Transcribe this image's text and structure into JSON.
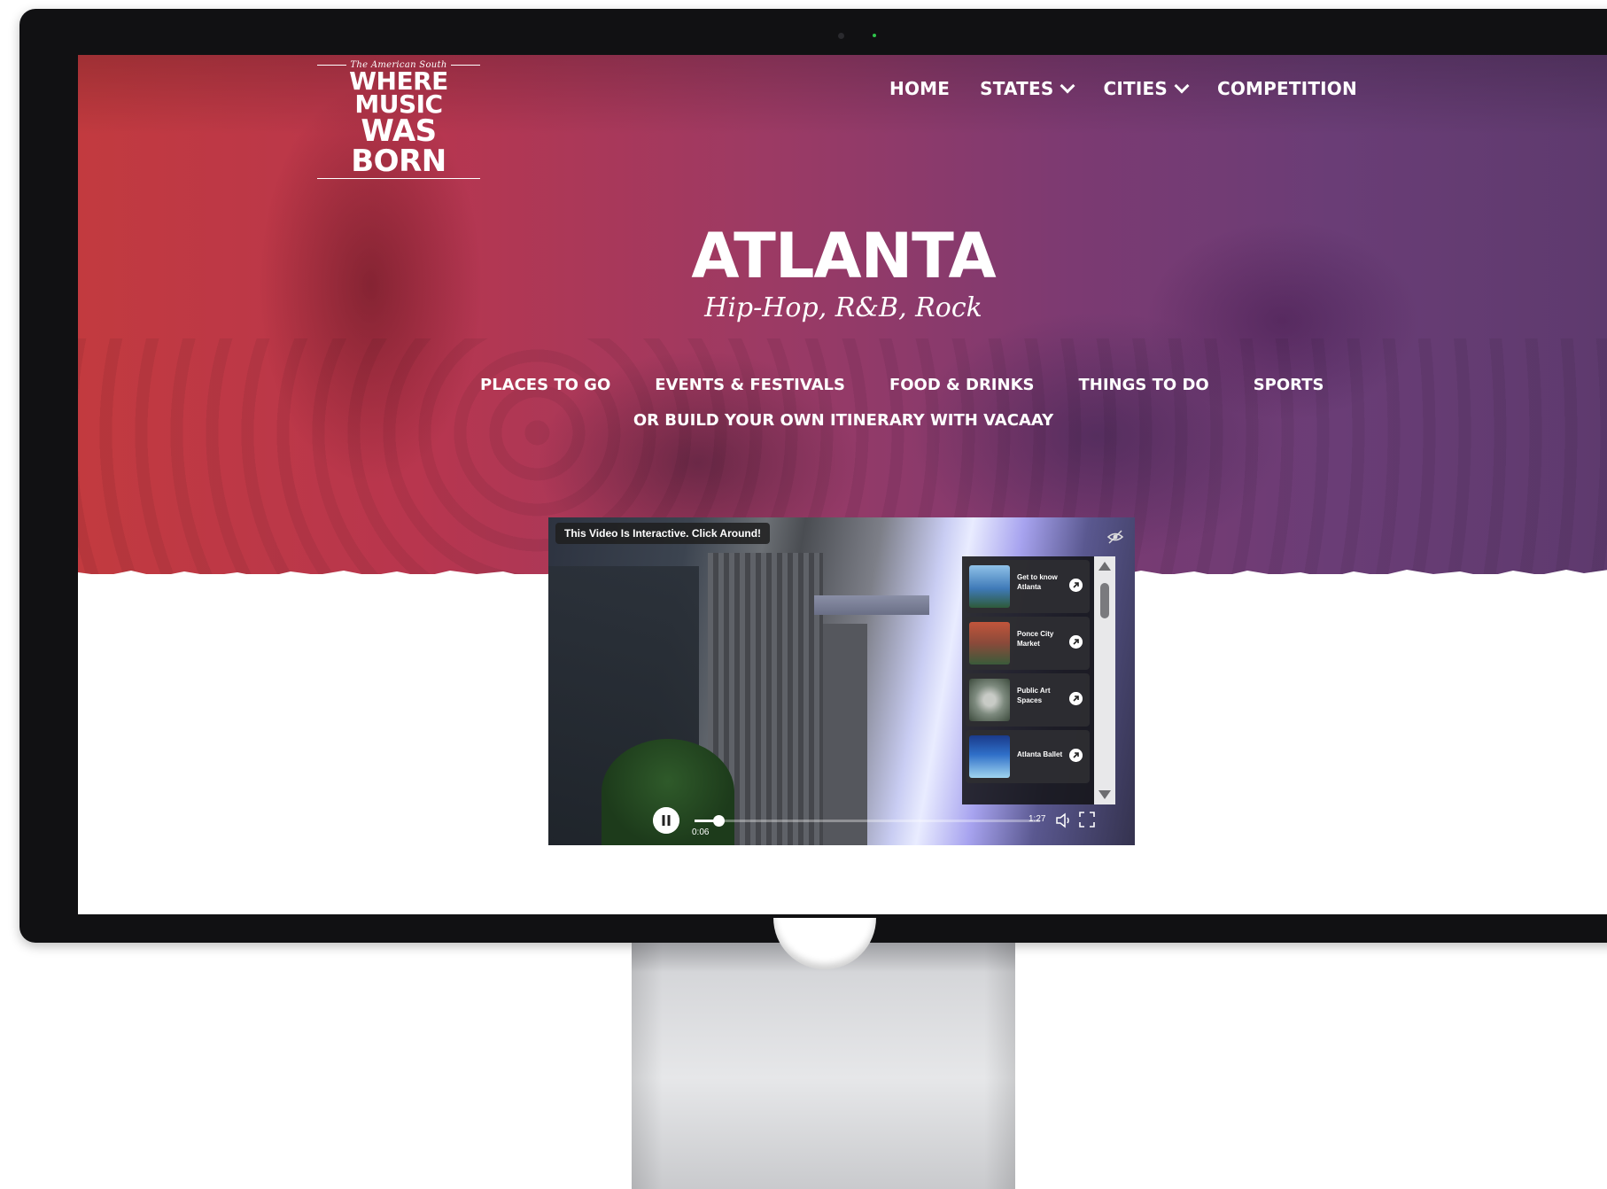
{
  "colors": {
    "accent_hero_left": "#c23a3f",
    "accent_hero_right": "#5e3a6e",
    "bezel": "#111113"
  },
  "logo": {
    "tagline": "The American South",
    "line1": "WHERE MUSIC",
    "line2": "WAS BORN"
  },
  "nav": {
    "items": [
      {
        "label": "HOME",
        "has_dropdown": false
      },
      {
        "label": "STATES",
        "has_dropdown": true
      },
      {
        "label": "CITIES",
        "has_dropdown": true
      },
      {
        "label": "COMPETITION",
        "has_dropdown": false
      }
    ]
  },
  "hero": {
    "title": "ATLANTA",
    "genres": "Hip-Hop, R&B, Rock"
  },
  "subnav": {
    "items": [
      "PLACES TO GO",
      "EVENTS & FESTIVALS",
      "FOOD & DRINKS",
      "THINGS TO DO",
      "SPORTS"
    ],
    "itinerary": "OR BUILD YOUR OWN ITINERARY WITH VACAAY"
  },
  "video": {
    "badge": "This Video Is Interactive. Click Around!",
    "playlist": [
      {
        "label": "Get to know Atlanta",
        "thumb_color": "#3f7ab8"
      },
      {
        "label": "Ponce City Market",
        "thumb_color": "#8a4a3a"
      },
      {
        "label": "Public Art Spaces",
        "thumb_color": "#7d8a7e"
      },
      {
        "label": "Atlanta Ballet",
        "thumb_color": "#2f6fc8"
      }
    ],
    "current_time": "0:06",
    "total_time": "1:27",
    "progress_fraction": 0.07,
    "state": "playing"
  }
}
